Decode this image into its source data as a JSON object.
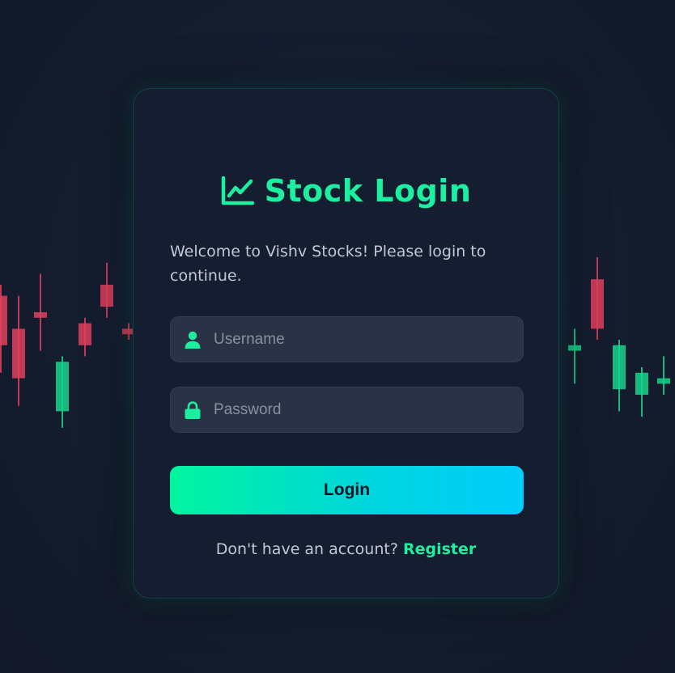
{
  "login_card": {
    "title": "Stock Login",
    "title_icon": "chart-line-icon",
    "welcome_text": "Welcome to Vishv Stocks! Please login to continue.",
    "username": {
      "icon": "user-icon",
      "placeholder": "Username",
      "value": ""
    },
    "password": {
      "icon": "lock-icon",
      "placeholder": "Password",
      "value": ""
    },
    "login_button_label": "Login",
    "register_prompt": "Don't have an account?",
    "register_link_label": "Register"
  },
  "colors": {
    "accent": "#1cf0a0",
    "background": "#141c2e",
    "card": "#151e30",
    "input": "#2a3345",
    "candle_up": "#18d58c",
    "candle_down": "#e0405e",
    "button_gradient_start": "#00f59e",
    "button_gradient_end": "#00cdfb"
  },
  "background_candles": [
    {
      "direction": "down",
      "high": 60,
      "open": 58,
      "close": 49,
      "low": 44
    },
    {
      "direction": "down",
      "high": 58,
      "open": 52,
      "close": 43,
      "low": 38
    },
    {
      "direction": "down",
      "high": 62,
      "open": 55,
      "close": 54,
      "low": 48
    },
    {
      "direction": "up",
      "high": 47,
      "open": 37,
      "close": 46,
      "low": 34
    },
    {
      "direction": "down",
      "high": 54,
      "open": 53,
      "close": 49,
      "low": 47
    },
    {
      "direction": "down",
      "high": 64,
      "open": 60,
      "close": 56,
      "low": 54
    },
    {
      "direction": "down",
      "high": 53,
      "open": 52,
      "close": 51,
      "low": 50
    },
    {
      "direction": "up",
      "high": 52,
      "open": 48,
      "close": 49,
      "low": 42
    },
    {
      "direction": "down",
      "high": 65,
      "open": 61,
      "close": 52,
      "low": 50
    },
    {
      "direction": "up",
      "high": 50,
      "open": 41,
      "close": 49,
      "low": 37
    },
    {
      "direction": "up",
      "high": 45,
      "open": 40,
      "close": 44,
      "low": 36
    },
    {
      "direction": "up",
      "high": 47,
      "open": 42,
      "close": 43,
      "low": 40
    }
  ]
}
